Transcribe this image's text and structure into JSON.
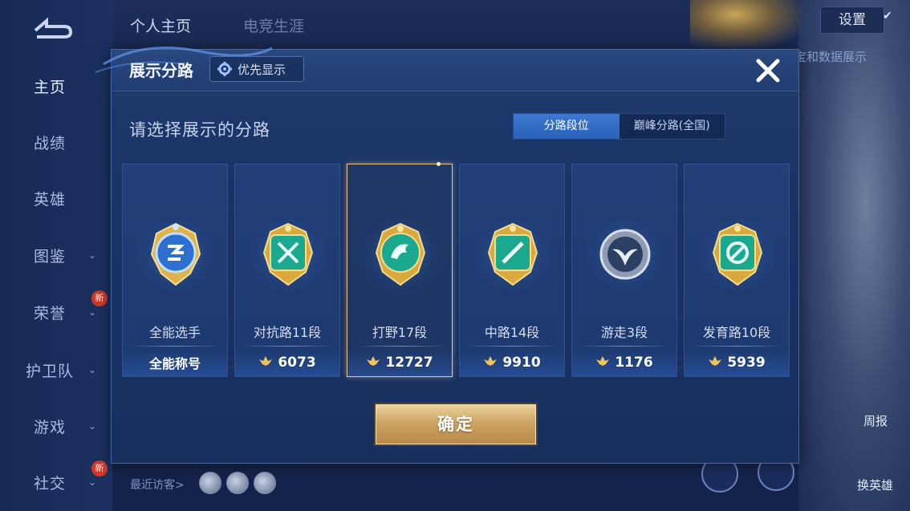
{
  "background": {
    "top_tabs": [
      "个人主页",
      "电竞生涯"
    ],
    "nav": [
      {
        "label": "主页",
        "active": true,
        "chevron": false,
        "new": false
      },
      {
        "label": "战绩",
        "active": false,
        "chevron": false,
        "new": false
      },
      {
        "label": "英雄",
        "active": false,
        "chevron": false,
        "new": false
      },
      {
        "label": "图鉴",
        "active": false,
        "chevron": true,
        "new": false
      },
      {
        "label": "荣誉",
        "active": false,
        "chevron": true,
        "new": true
      },
      {
        "label": "护卫队",
        "active": false,
        "chevron": true,
        "new": false
      },
      {
        "label": "游戏",
        "active": false,
        "chevron": true,
        "new": false
      },
      {
        "label": "社交",
        "active": false,
        "chevron": true,
        "new": true
      }
    ],
    "new_badge_text": "新",
    "settings_label": "设置",
    "data_display_text": "宝和数据展示",
    "recent_visitors_label": "最近访客>",
    "weekly_report_label": "周报",
    "change_hero_label": "换英雄"
  },
  "modal": {
    "title": "展示分路",
    "priority_button": "优先显示",
    "prompt": "请选择展示的分路",
    "segment_tabs": [
      {
        "label": "分路段位",
        "active": true
      },
      {
        "label": "巅峰分路(全国)",
        "active": false
      }
    ],
    "cards": [
      {
        "name": "全能选手",
        "value": "全能称号",
        "selected": false,
        "icon": "all-round-badge-icon",
        "kind": "title"
      },
      {
        "name": "对抗路11段",
        "value": "6073",
        "selected": false,
        "icon": "clash-lane-badge-icon",
        "kind": "score"
      },
      {
        "name": "打野17段",
        "value": "12727",
        "selected": true,
        "icon": "jungle-badge-icon",
        "kind": "score"
      },
      {
        "name": "中路14段",
        "value": "9910",
        "selected": false,
        "icon": "mid-lane-badge-icon",
        "kind": "score"
      },
      {
        "name": "游走3段",
        "value": "1176",
        "selected": false,
        "icon": "roam-badge-icon",
        "kind": "score"
      },
      {
        "name": "发育路10段",
        "value": "5939",
        "selected": false,
        "icon": "farm-lane-badge-icon",
        "kind": "score"
      }
    ],
    "confirm_button": "确定"
  },
  "colors": {
    "accent_blue": "#2f6cc4",
    "gold": "#cda462",
    "selected_border": "#e9c88a",
    "badge_teal": "#1aa88f",
    "badge_gold": "#d9a93e"
  }
}
